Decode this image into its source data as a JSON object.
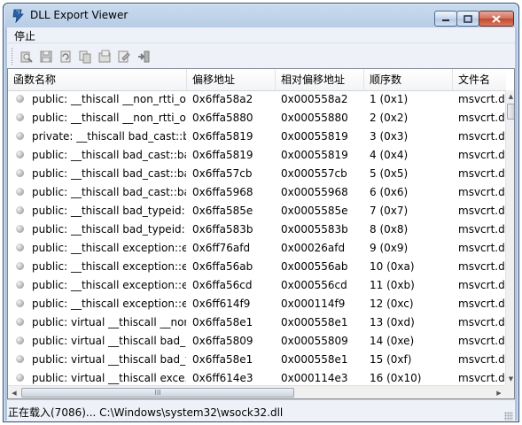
{
  "window": {
    "title": "DLL Export Viewer"
  },
  "menu": {
    "items": [
      "停止"
    ]
  },
  "toolbar": {
    "buttons": [
      {
        "name": "properties-icon"
      },
      {
        "name": "save-icon"
      },
      {
        "name": "refresh-icon"
      },
      {
        "name": "copy-icon"
      },
      {
        "name": "html-report-icon"
      },
      {
        "name": "options-icon"
      },
      {
        "name": "exit-icon"
      }
    ]
  },
  "columns": [
    "函数名称",
    "偏移地址",
    "相对偏移地址",
    "顺序数",
    "文件名"
  ],
  "rows": [
    [
      "public: __thiscall __non_rtti_o...",
      "0x6ffa58a2",
      "0x000558a2",
      "1 (0x1)",
      "msvcrt.d"
    ],
    [
      "public: __thiscall __non_rtti_o...",
      "0x6ffa5880",
      "0x00055880",
      "2 (0x2)",
      "msvcrt.d"
    ],
    [
      "private: __thiscall bad_cast::b...",
      "0x6ffa5819",
      "0x00055819",
      "3 (0x3)",
      "msvcrt.d"
    ],
    [
      "public: __thiscall bad_cast::ba...",
      "0x6ffa5819",
      "0x00055819",
      "4 (0x4)",
      "msvcrt.d"
    ],
    [
      "public: __thiscall bad_cast::ba...",
      "0x6ffa57cb",
      "0x000557cb",
      "5 (0x5)",
      "msvcrt.d"
    ],
    [
      "public: __thiscall bad_cast::ba...",
      "0x6ffa5968",
      "0x00055968",
      "6 (0x6)",
      "msvcrt.d"
    ],
    [
      "public: __thiscall bad_typeid::...",
      "0x6ffa585e",
      "0x0005585e",
      "7 (0x7)",
      "msvcrt.d"
    ],
    [
      "public: __thiscall bad_typeid::...",
      "0x6ffa583b",
      "0x0005583b",
      "8 (0x8)",
      "msvcrt.d"
    ],
    [
      "public: __thiscall exception::e...",
      "0x6ff76afd",
      "0x00026afd",
      "9 (0x9)",
      "msvcrt.d"
    ],
    [
      "public: __thiscall exception::e...",
      "0x6ffa56ab",
      "0x000556ab",
      "10 (0xa)",
      "msvcrt.d"
    ],
    [
      "public: __thiscall exception::e...",
      "0x6ffa56cd",
      "0x000556cd",
      "11 (0xb)",
      "msvcrt.d"
    ],
    [
      "public: __thiscall exception::e...",
      "0x6ff614f9",
      "0x000114f9",
      "12 (0xc)",
      "msvcrt.d"
    ],
    [
      "public: virtual __thiscall __non...",
      "0x6ffa58e1",
      "0x000558e1",
      "13 (0xd)",
      "msvcrt.d"
    ],
    [
      "public: virtual __thiscall bad_...",
      "0x6ffa5809",
      "0x00055809",
      "14 (0xe)",
      "msvcrt.d"
    ],
    [
      "public: virtual __thiscall bad_t...",
      "0x6ffa58e1",
      "0x000558e1",
      "15 (0xf)",
      "msvcrt.d"
    ],
    [
      "public: virtual __thiscall exce...",
      "0x6ff614e3",
      "0x000114e3",
      "16 (0x10)",
      "msvcrt.d"
    ]
  ],
  "status": {
    "text": "正在载入(7086)... C:\\Windows\\system32\\wsock32.dll"
  },
  "scrollbar": {
    "h_thumb_grip": "III"
  }
}
